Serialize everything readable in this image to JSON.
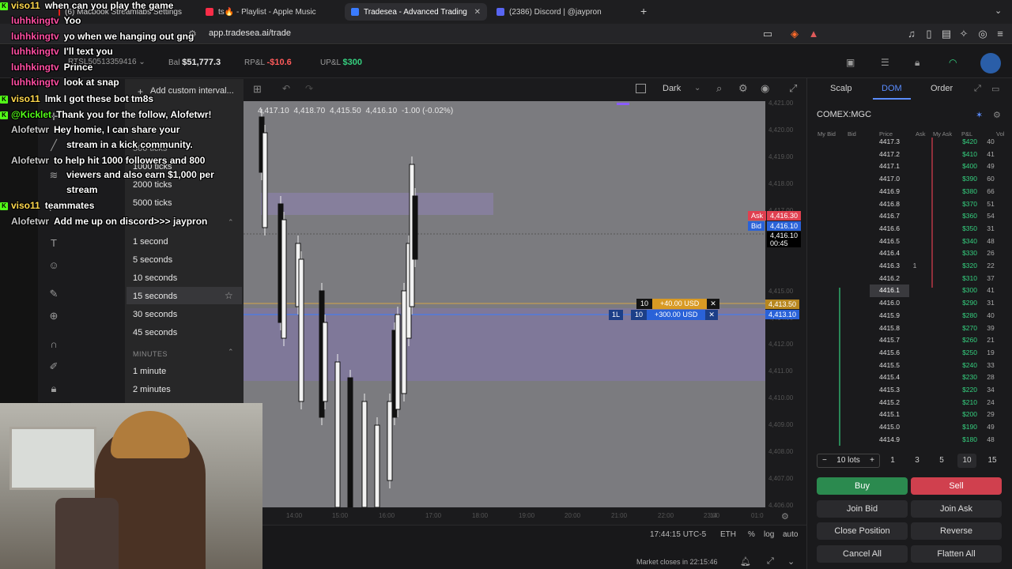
{
  "browser": {
    "tabs": [
      {
        "label": "(6) Macbook Streamlabs Settings",
        "color": "#e62117"
      },
      {
        "label": "ts🔥 - Playlist - Apple Music",
        "color": "#fa2d48"
      },
      {
        "label": "Tradesea - Advanced Trading",
        "color": "#3a7bff"
      },
      {
        "label": "(2386) Discord | @jaypron",
        "color": "#5865f2"
      }
    ],
    "new_tab": "+",
    "url": "app.tradesea.ai/trade"
  },
  "account": {
    "id": "RTSL50513359416",
    "bal_label": "Bal",
    "bal": "$51,777.3",
    "rpl_label": "RP&L",
    "rpl": "-$10.6",
    "upl_label": "UP&L",
    "upl": "$300"
  },
  "chart": {
    "ohlc": [
      "4,417.10",
      "4,418.70",
      "4,415.50",
      "4,416.10",
      "-1.00 (-0.02%)"
    ],
    "theme": "Dark",
    "ask_label": "Ask",
    "ask": "4,416.30",
    "bid_label": "Bid",
    "bid": "4,416.10",
    "last": "4,416.10",
    "countdown": "00:45",
    "order1_qty": "10",
    "order1_pnl": "+40.00 USD",
    "order1_price": "4,413.50",
    "order2_qty": "10",
    "order2_pnl": "+300.00 USD",
    "order2_price": "4,413.10",
    "order2_side": "1L",
    "time_display": "17:44:15 UTC-5",
    "session": "ETH",
    "pct": "%",
    "log": "log",
    "auto": "auto",
    "market_close": "Market closes in 22:15:46",
    "price_ticks": [
      "4,421.00",
      "4,420.00",
      "4,419.00",
      "4,418.00",
      "4,417.00",
      "4,415.00",
      "4,414.00",
      "4,412.00",
      "4,411.00",
      "4,410.00",
      "4,409.00",
      "4,408.00",
      "4,407.00",
      "4,406.00"
    ],
    "time_ticks": [
      "14:00",
      "15:00",
      "16:00",
      "17:00",
      "18:00",
      "19:00",
      "20:00",
      "21:00",
      "22:00",
      "23:00",
      "14",
      "01:0"
    ]
  },
  "interval_menu": {
    "add_custom": "Add custom interval...",
    "ticks": [
      "500 ticks",
      "1000 ticks",
      "2000 ticks",
      "5000 ticks"
    ],
    "seconds": [
      "1 second",
      "5 seconds",
      "10 seconds",
      "15 seconds",
      "30 seconds",
      "45 seconds"
    ],
    "minutes_header": "MINUTES",
    "minutes": [
      "1 minute",
      "2 minutes"
    ]
  },
  "panel": {
    "tabs": [
      "Scalp",
      "DOM",
      "Order"
    ],
    "symbol": "COMEX:MGC",
    "headers": [
      "My Bid",
      "Bid",
      "Price",
      "Ask",
      "My Ask",
      "P&L",
      "Vol"
    ],
    "rows": [
      {
        "price": "4417.3",
        "ask": "",
        "pnl": "$420",
        "vol": "40"
      },
      {
        "price": "4417.2",
        "ask": "",
        "pnl": "$410",
        "vol": "41"
      },
      {
        "price": "4417.1",
        "ask": "",
        "pnl": "$400",
        "vol": "49"
      },
      {
        "price": "4417.0",
        "ask": "",
        "pnl": "$390",
        "vol": "60"
      },
      {
        "price": "4416.9",
        "ask": "",
        "pnl": "$380",
        "vol": "66"
      },
      {
        "price": "4416.8",
        "ask": "",
        "pnl": "$370",
        "vol": "51"
      },
      {
        "price": "4416.7",
        "ask": "",
        "pnl": "$360",
        "vol": "54"
      },
      {
        "price": "4416.6",
        "ask": "",
        "pnl": "$350",
        "vol": "31"
      },
      {
        "price": "4416.5",
        "ask": "",
        "pnl": "$340",
        "vol": "48"
      },
      {
        "price": "4416.4",
        "ask": "",
        "pnl": "$330",
        "vol": "26"
      },
      {
        "price": "4416.3",
        "ask": "1",
        "pnl": "$320",
        "vol": "22"
      },
      {
        "price": "4416.2",
        "ask": "",
        "pnl": "$310",
        "vol": "37"
      },
      {
        "price": "4416.1",
        "ask": "",
        "pnl": "$300",
        "vol": "41"
      },
      {
        "price": "4416.0",
        "ask": "",
        "pnl": "$290",
        "vol": "31"
      },
      {
        "price": "4415.9",
        "ask": "",
        "pnl": "$280",
        "vol": "40"
      },
      {
        "price": "4415.8",
        "ask": "",
        "pnl": "$270",
        "vol": "39"
      },
      {
        "price": "4415.7",
        "ask": "",
        "pnl": "$260",
        "vol": "21"
      },
      {
        "price": "4415.6",
        "ask": "",
        "pnl": "$250",
        "vol": "19"
      },
      {
        "price": "4415.5",
        "ask": "",
        "pnl": "$240",
        "vol": "33"
      },
      {
        "price": "4415.4",
        "ask": "",
        "pnl": "$230",
        "vol": "28"
      },
      {
        "price": "4415.3",
        "ask": "",
        "pnl": "$220",
        "vol": "34"
      },
      {
        "price": "4415.2",
        "ask": "",
        "pnl": "$210",
        "vol": "24"
      },
      {
        "price": "4415.1",
        "ask": "",
        "pnl": "$200",
        "vol": "29"
      },
      {
        "price": "4415.0",
        "ask": "",
        "pnl": "$190",
        "vol": "49"
      },
      {
        "price": "4414.9",
        "ask": "",
        "pnl": "$180",
        "vol": "48"
      }
    ],
    "lots_label": "10 lots",
    "quick_lots": [
      "1",
      "3",
      "5",
      "10",
      "15"
    ],
    "buy": "Buy",
    "sell": "Sell",
    "join_bid": "Join Bid",
    "join_ask": "Join Ask",
    "close_position": "Close Position",
    "reverse": "Reverse",
    "cancel_all": "Cancel All",
    "flatten_all": "Flatten All"
  },
  "chat": [
    {
      "badge": true,
      "name": "viso11",
      "name_color": "#ffd84d",
      "msg": "when can you play the game"
    },
    {
      "badge": false,
      "name": "luhhkingtv",
      "name_color": "#ff4fa3",
      "msg": "Yoo"
    },
    {
      "badge": false,
      "name": "luhhkingtv",
      "name_color": "#ff4fa3",
      "msg": "yo when we hanging out gng"
    },
    {
      "badge": false,
      "name": "luhhkingtv",
      "name_color": "#ff4fa3",
      "msg": "I'll text you"
    },
    {
      "badge": false,
      "name": "luhhkingtv",
      "name_color": "#ff4fa3",
      "msg": "Prince"
    },
    {
      "badge": false,
      "name": "luhhkingtv",
      "name_color": "#ff4fa3",
      "msg": "look at snap"
    },
    {
      "badge": true,
      "name": "viso11",
      "name_color": "#ffd84d",
      "msg": "lmk I got these bot tm8s"
    },
    {
      "badge": true,
      "name": "@Kicklet",
      "name_color": "#53fc18",
      "msg": "Thank you for the follow, Alofetwr!"
    },
    {
      "badge": false,
      "name": "Alofetwr",
      "name_color": "#c9c9c9",
      "msg": "Hey homie, I can share your"
    },
    {
      "badge": false,
      "name": "",
      "name_color": "#c9c9c9",
      "msg": "stream in a kick community."
    },
    {
      "badge": false,
      "name": "Alofetwr",
      "name_color": "#c9c9c9",
      "msg": "to help hit 1000 followers and 800"
    },
    {
      "badge": false,
      "name": "",
      "name_color": "#c9c9c9",
      "msg": "viewers and also earn $1,000 per"
    },
    {
      "badge": false,
      "name": "",
      "name_color": "#c9c9c9",
      "msg": "stream"
    },
    {
      "badge": true,
      "name": "viso11",
      "name_color": "#ffd84d",
      "msg": "teammates"
    },
    {
      "badge": false,
      "name": "Alofetwr",
      "name_color": "#c9c9c9",
      "msg": "Add me up on discord>>> jaypron"
    }
  ]
}
